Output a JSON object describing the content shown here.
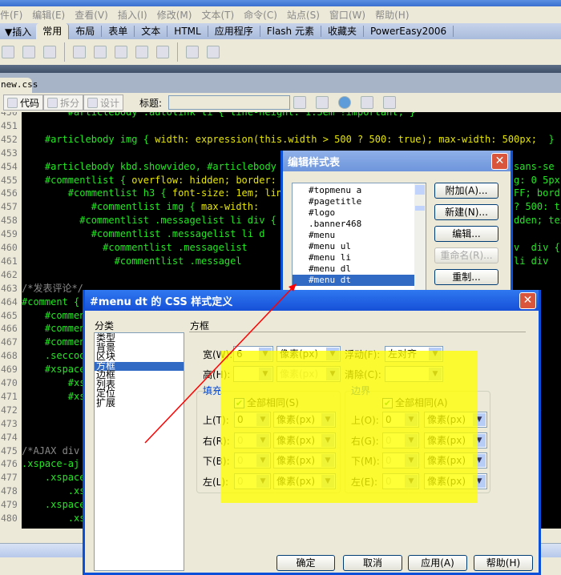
{
  "menu": [
    "件(F)",
    "编辑(E)",
    "查看(V)",
    "插入(I)",
    "修改(M)",
    "文本(T)",
    "命令(C)",
    "站点(S)",
    "窗口(W)",
    "帮助(H)"
  ],
  "insert_bar": {
    "toggle": "▼插入",
    "tabs": [
      "常用",
      "布局",
      "表单",
      "文本",
      "HTML",
      "应用程序",
      "Flash 元素",
      "收藏夹",
      "PowerEasy2006"
    ],
    "active": "常用"
  },
  "doc_tab": "new.css",
  "doc_toolbar": {
    "code": "代码",
    "split": "拆分",
    "design": "设计",
    "title_label": "标题:",
    "title_value": ""
  },
  "code_lines": [
    {
      "n": "450",
      "indent": "        ",
      "segs": [
        [
          "g",
          "#articlebody .autolink li { line-height: 1.5em !important; }"
        ]
      ],
      "right": ""
    },
    {
      "n": "451",
      "indent": "",
      "segs": [],
      "right": ""
    },
    {
      "n": "452",
      "indent": "    ",
      "segs": [
        [
          "g",
          "#articlebody img { "
        ],
        [
          "y",
          "width: expression(this.width > 500 ? 500: true); max-width: 500px;  "
        ],
        [
          "g",
          "}"
        ]
      ],
      "right": ""
    },
    {
      "n": "453",
      "indent": "",
      "segs": [],
      "right": ""
    },
    {
      "n": "454",
      "indent": "    ",
      "segs": [
        [
          "g",
          "#articlebody kbd.showvideo, #articlebody k"
        ]
      ],
      "right": "sans-se"
    },
    {
      "n": "455",
      "indent": "    ",
      "segs": [
        [
          "g",
          "#commentlist { "
        ],
        [
          "y",
          "overflow: hidden; border: 1"
        ]
      ],
      "right": "g: 0 5px;"
    },
    {
      "n": "456",
      "indent": "        ",
      "segs": [
        [
          "g",
          "#commentlist h3 { "
        ],
        [
          "y",
          "font-size: 1em; line"
        ]
      ],
      "right": "FF; bord"
    },
    {
      "n": "457",
      "indent": "            ",
      "segs": [
        [
          "g",
          "#commentlist img { "
        ],
        [
          "y",
          "max-width:"
        ]
      ],
      "right": "? 500: t"
    },
    {
      "n": "458",
      "indent": "          ",
      "segs": [
        [
          "g",
          "#commentlist .messagelist li div {"
        ]
      ],
      "right": "dden; tex"
    },
    {
      "n": "459",
      "indent": "            ",
      "segs": [
        [
          "g",
          "#commentlist .messagelist li d"
        ]
      ],
      "right": ""
    },
    {
      "n": "460",
      "indent": "              ",
      "segs": [
        [
          "g",
          "#commentlist .messagelist"
        ]
      ],
      "right": "v  div {"
    },
    {
      "n": "461",
      "indent": "                ",
      "segs": [
        [
          "g",
          "#commentlist .messagel"
        ]
      ],
      "right": "li div"
    },
    {
      "n": "462",
      "indent": "",
      "segs": [],
      "right": ""
    },
    {
      "n": "463",
      "indent": "",
      "segs": [
        [
          "c",
          "/*发表评论*/"
        ]
      ],
      "right": ""
    },
    {
      "n": "464",
      "indent": "",
      "segs": [
        [
          "g",
          "#comment {"
        ]
      ],
      "right": ""
    },
    {
      "n": "465",
      "indent": "    ",
      "segs": [
        [
          "g",
          "#commen"
        ]
      ],
      "right": ""
    },
    {
      "n": "466",
      "indent": "    ",
      "segs": [
        [
          "g",
          "#commen"
        ]
      ],
      "right": ""
    },
    {
      "n": "467",
      "indent": "    ",
      "segs": [
        [
          "g",
          "#commen"
        ]
      ],
      "right": ""
    },
    {
      "n": "468",
      "indent": "    ",
      "segs": [
        [
          "g",
          ".seccod"
        ]
      ],
      "right": ""
    },
    {
      "n": "469",
      "indent": "    ",
      "segs": [
        [
          "g",
          "#xspace"
        ]
      ],
      "right": ""
    },
    {
      "n": "470",
      "indent": "        ",
      "segs": [
        [
          "g",
          "#xs"
        ]
      ],
      "right": "20p"
    },
    {
      "n": "471",
      "indent": "        ",
      "segs": [
        [
          "g",
          "#xs"
        ]
      ],
      "right": ""
    },
    {
      "n": "472",
      "indent": "",
      "segs": [],
      "right": "#xsp"
    },
    {
      "n": "473",
      "indent": "",
      "segs": [],
      "right": ""
    },
    {
      "n": "474",
      "indent": "",
      "segs": [],
      "right": ""
    },
    {
      "n": "475",
      "indent": "",
      "segs": [
        [
          "c",
          "/*AJAX div"
        ]
      ],
      "right": ""
    },
    {
      "n": "476",
      "indent": "",
      "segs": [
        [
          "g",
          ".xspace-aj"
        ]
      ],
      "right": "F;"
    },
    {
      "n": "477",
      "indent": "    ",
      "segs": [
        [
          "g",
          ".xspace"
        ]
      ],
      "right": ""
    },
    {
      "n": "478",
      "indent": "        ",
      "segs": [
        [
          "g",
          ".xs"
        ]
      ],
      "right": ""
    },
    {
      "n": "479",
      "indent": "    ",
      "segs": [
        [
          "g",
          ".xspace"
        ]
      ],
      "right": ""
    },
    {
      "n": "480",
      "indent": "        ",
      "segs": [
        [
          "g",
          ".xs"
        ]
      ],
      "right": ""
    }
  ],
  "stylesheet_dialog": {
    "title": "编辑样式表",
    "items": [
      "#topmenu a",
      "#pagetitle",
      "#logo",
      ".banner468",
      "#menu",
      "#menu ul",
      "#menu li",
      "#menu dl",
      "#menu dt"
    ],
    "selected": "#menu dt",
    "buttons": {
      "attach": "附加(A)...",
      "new": "新建(N)...",
      "edit": "编辑...",
      "rename": "重命名(R)...",
      "duplicate": "重制..."
    }
  },
  "css_dialog": {
    "title": "#menu dt 的 CSS 样式定义",
    "category_label": "分类",
    "categories": [
      "类型",
      "背景",
      "区块",
      "方框",
      "边框",
      "列表",
      "定位",
      "扩展"
    ],
    "selected_category": "方框",
    "section_title": "方框",
    "width_label": "宽(W):",
    "width_value": "6",
    "width_unit": "像素(px)",
    "height_label": "高(H):",
    "height_value": "",
    "height_unit": "像素(px)",
    "float_label": "浮动(F):",
    "float_value": "左对齐",
    "clear_label": "清除(C):",
    "clear_value": "",
    "padding": {
      "title": "填充",
      "same_label": "全部相同(S)",
      "same_checked": true,
      "rows": [
        {
          "label": "上(T):",
          "value": "0",
          "unit": "像素(px)"
        },
        {
          "label": "右(R):",
          "value": "0",
          "unit": "像素(px)"
        },
        {
          "label": "下(B):",
          "value": "0",
          "unit": "像素(px)"
        },
        {
          "label": "左(L):",
          "value": "0",
          "unit": "像素(px)"
        }
      ]
    },
    "margin": {
      "title": "边界",
      "same_label": "全部相同(A)",
      "same_checked": true,
      "rows": [
        {
          "label": "上(O):",
          "value": "0",
          "unit": "像素(px)"
        },
        {
          "label": "右(G):",
          "value": "0",
          "unit": "像素(px)"
        },
        {
          "label": "下(M):",
          "value": "0",
          "unit": "像素(px)"
        },
        {
          "label": "左(E):",
          "value": "0",
          "unit": "像素(px)"
        }
      ]
    },
    "buttons": {
      "ok": "确定",
      "cancel": "取消",
      "apply": "应用(A)",
      "help": "帮助(H)"
    }
  },
  "colors": {
    "highlight": "#ffff00",
    "annotation_arrow": "#ff0000",
    "code_text": "#22e622",
    "code_property": "#e6e600",
    "title_bar": "#0a50d8"
  }
}
